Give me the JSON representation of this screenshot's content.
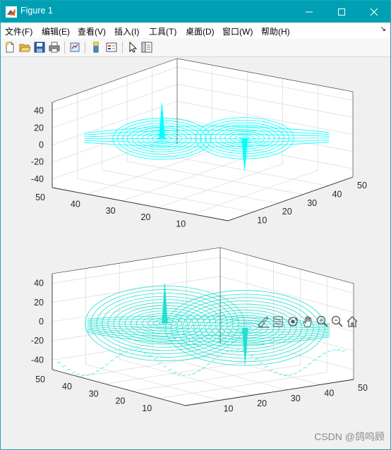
{
  "window": {
    "title": "Figure 1",
    "accent_color": "#00a0b4",
    "controls": [
      "minimize-icon",
      "maximize-icon",
      "close-icon"
    ]
  },
  "menu": [
    {
      "label": "文件(F)"
    },
    {
      "label": "编辑(E)"
    },
    {
      "label": "查看(V)"
    },
    {
      "label": "插入(I)"
    },
    {
      "label": "工具(T)"
    },
    {
      "label": "桌面(D)"
    },
    {
      "label": "窗口(W)"
    },
    {
      "label": "帮助(H)"
    }
  ],
  "toolbar": {
    "buttons": [
      "new-figure-icon",
      "open-file-icon",
      "save-icon",
      "print-icon",
      "link-plot-icon",
      "colorbar-icon",
      "legend-icon",
      "select-arrow-icon",
      "property-inspector-icon"
    ]
  },
  "axes_toolbar": {
    "buttons": [
      "brush-icon",
      "data-tips-icon",
      "rotate-3d-icon",
      "pan-icon",
      "zoom-in-icon",
      "zoom-out-icon",
      "home-icon"
    ]
  },
  "chart_data": [
    {
      "type": "3d-streamlines",
      "title": "",
      "series_color": "#00ffff",
      "x_ticks": [
        "10",
        "20",
        "30",
        "40",
        "50"
      ],
      "y_ticks": [
        "10",
        "20",
        "30",
        "40",
        "50"
      ],
      "z_ticks": [
        "40",
        "20",
        "0",
        "-20",
        "-40"
      ],
      "xlim": [
        0,
        50
      ],
      "ylim": [
        0,
        50
      ],
      "zlim": [
        -50,
        50
      ],
      "grid": true
    },
    {
      "type": "3d-streamlines",
      "title": "",
      "series_color": "#22e0d0",
      "x_ticks": [
        "10",
        "20",
        "30",
        "40",
        "50"
      ],
      "y_ticks": [
        "10",
        "20",
        "30",
        "40",
        "50"
      ],
      "z_ticks": [
        "40",
        "20",
        "0",
        "-20",
        "-40"
      ],
      "xlim": [
        0,
        50
      ],
      "ylim": [
        0,
        50
      ],
      "zlim": [
        -50,
        50
      ],
      "grid": true
    }
  ],
  "watermark": "CSDN @鸽呜顾"
}
